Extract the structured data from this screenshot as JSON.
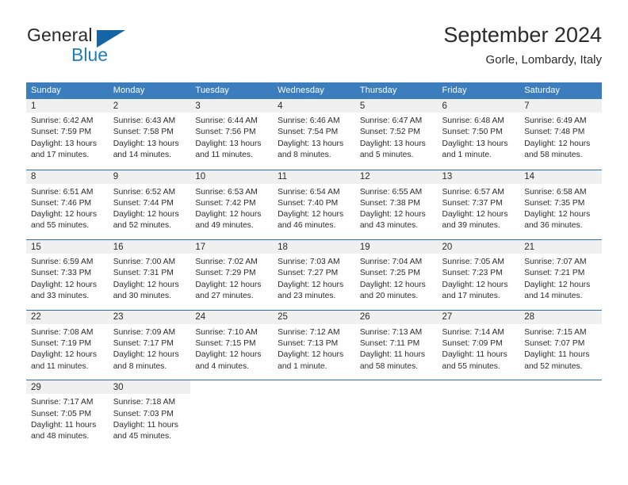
{
  "brand": {
    "name_part1": "General",
    "name_part2": "Blue",
    "triangle_color": "#1565a6",
    "blue_color": "#1f7ec4"
  },
  "header": {
    "title": "September 2024",
    "subtitle": "Gorle, Lombardy, Italy"
  },
  "theme": {
    "header_row_bg": "#3c7ebd",
    "week_divider": "#2f6fae",
    "day_band_bg": "#f0f0f0",
    "text": "#2b2b2b"
  },
  "weekday_headers": [
    "Sunday",
    "Monday",
    "Tuesday",
    "Wednesday",
    "Thursday",
    "Friday",
    "Saturday"
  ],
  "weeks": [
    [
      {
        "day": "1",
        "sunrise": "Sunrise: 6:42 AM",
        "sunset": "Sunset: 7:59 PM",
        "daylight_line1": "Daylight: 13 hours",
        "daylight_line2": "and 17 minutes."
      },
      {
        "day": "2",
        "sunrise": "Sunrise: 6:43 AM",
        "sunset": "Sunset: 7:58 PM",
        "daylight_line1": "Daylight: 13 hours",
        "daylight_line2": "and 14 minutes."
      },
      {
        "day": "3",
        "sunrise": "Sunrise: 6:44 AM",
        "sunset": "Sunset: 7:56 PM",
        "daylight_line1": "Daylight: 13 hours",
        "daylight_line2": "and 11 minutes."
      },
      {
        "day": "4",
        "sunrise": "Sunrise: 6:46 AM",
        "sunset": "Sunset: 7:54 PM",
        "daylight_line1": "Daylight: 13 hours",
        "daylight_line2": "and 8 minutes."
      },
      {
        "day": "5",
        "sunrise": "Sunrise: 6:47 AM",
        "sunset": "Sunset: 7:52 PM",
        "daylight_line1": "Daylight: 13 hours",
        "daylight_line2": "and 5 minutes."
      },
      {
        "day": "6",
        "sunrise": "Sunrise: 6:48 AM",
        "sunset": "Sunset: 7:50 PM",
        "daylight_line1": "Daylight: 13 hours",
        "daylight_line2": "and 1 minute."
      },
      {
        "day": "7",
        "sunrise": "Sunrise: 6:49 AM",
        "sunset": "Sunset: 7:48 PM",
        "daylight_line1": "Daylight: 12 hours",
        "daylight_line2": "and 58 minutes."
      }
    ],
    [
      {
        "day": "8",
        "sunrise": "Sunrise: 6:51 AM",
        "sunset": "Sunset: 7:46 PM",
        "daylight_line1": "Daylight: 12 hours",
        "daylight_line2": "and 55 minutes."
      },
      {
        "day": "9",
        "sunrise": "Sunrise: 6:52 AM",
        "sunset": "Sunset: 7:44 PM",
        "daylight_line1": "Daylight: 12 hours",
        "daylight_line2": "and 52 minutes."
      },
      {
        "day": "10",
        "sunrise": "Sunrise: 6:53 AM",
        "sunset": "Sunset: 7:42 PM",
        "daylight_line1": "Daylight: 12 hours",
        "daylight_line2": "and 49 minutes."
      },
      {
        "day": "11",
        "sunrise": "Sunrise: 6:54 AM",
        "sunset": "Sunset: 7:40 PM",
        "daylight_line1": "Daylight: 12 hours",
        "daylight_line2": "and 46 minutes."
      },
      {
        "day": "12",
        "sunrise": "Sunrise: 6:55 AM",
        "sunset": "Sunset: 7:38 PM",
        "daylight_line1": "Daylight: 12 hours",
        "daylight_line2": "and 43 minutes."
      },
      {
        "day": "13",
        "sunrise": "Sunrise: 6:57 AM",
        "sunset": "Sunset: 7:37 PM",
        "daylight_line1": "Daylight: 12 hours",
        "daylight_line2": "and 39 minutes."
      },
      {
        "day": "14",
        "sunrise": "Sunrise: 6:58 AM",
        "sunset": "Sunset: 7:35 PM",
        "daylight_line1": "Daylight: 12 hours",
        "daylight_line2": "and 36 minutes."
      }
    ],
    [
      {
        "day": "15",
        "sunrise": "Sunrise: 6:59 AM",
        "sunset": "Sunset: 7:33 PM",
        "daylight_line1": "Daylight: 12 hours",
        "daylight_line2": "and 33 minutes."
      },
      {
        "day": "16",
        "sunrise": "Sunrise: 7:00 AM",
        "sunset": "Sunset: 7:31 PM",
        "daylight_line1": "Daylight: 12 hours",
        "daylight_line2": "and 30 minutes."
      },
      {
        "day": "17",
        "sunrise": "Sunrise: 7:02 AM",
        "sunset": "Sunset: 7:29 PM",
        "daylight_line1": "Daylight: 12 hours",
        "daylight_line2": "and 27 minutes."
      },
      {
        "day": "18",
        "sunrise": "Sunrise: 7:03 AM",
        "sunset": "Sunset: 7:27 PM",
        "daylight_line1": "Daylight: 12 hours",
        "daylight_line2": "and 23 minutes."
      },
      {
        "day": "19",
        "sunrise": "Sunrise: 7:04 AM",
        "sunset": "Sunset: 7:25 PM",
        "daylight_line1": "Daylight: 12 hours",
        "daylight_line2": "and 20 minutes."
      },
      {
        "day": "20",
        "sunrise": "Sunrise: 7:05 AM",
        "sunset": "Sunset: 7:23 PM",
        "daylight_line1": "Daylight: 12 hours",
        "daylight_line2": "and 17 minutes."
      },
      {
        "day": "21",
        "sunrise": "Sunrise: 7:07 AM",
        "sunset": "Sunset: 7:21 PM",
        "daylight_line1": "Daylight: 12 hours",
        "daylight_line2": "and 14 minutes."
      }
    ],
    [
      {
        "day": "22",
        "sunrise": "Sunrise: 7:08 AM",
        "sunset": "Sunset: 7:19 PM",
        "daylight_line1": "Daylight: 12 hours",
        "daylight_line2": "and 11 minutes."
      },
      {
        "day": "23",
        "sunrise": "Sunrise: 7:09 AM",
        "sunset": "Sunset: 7:17 PM",
        "daylight_line1": "Daylight: 12 hours",
        "daylight_line2": "and 8 minutes."
      },
      {
        "day": "24",
        "sunrise": "Sunrise: 7:10 AM",
        "sunset": "Sunset: 7:15 PM",
        "daylight_line1": "Daylight: 12 hours",
        "daylight_line2": "and 4 minutes."
      },
      {
        "day": "25",
        "sunrise": "Sunrise: 7:12 AM",
        "sunset": "Sunset: 7:13 PM",
        "daylight_line1": "Daylight: 12 hours",
        "daylight_line2": "and 1 minute."
      },
      {
        "day": "26",
        "sunrise": "Sunrise: 7:13 AM",
        "sunset": "Sunset: 7:11 PM",
        "daylight_line1": "Daylight: 11 hours",
        "daylight_line2": "and 58 minutes."
      },
      {
        "day": "27",
        "sunrise": "Sunrise: 7:14 AM",
        "sunset": "Sunset: 7:09 PM",
        "daylight_line1": "Daylight: 11 hours",
        "daylight_line2": "and 55 minutes."
      },
      {
        "day": "28",
        "sunrise": "Sunrise: 7:15 AM",
        "sunset": "Sunset: 7:07 PM",
        "daylight_line1": "Daylight: 11 hours",
        "daylight_line2": "and 52 minutes."
      }
    ],
    [
      {
        "day": "29",
        "sunrise": "Sunrise: 7:17 AM",
        "sunset": "Sunset: 7:05 PM",
        "daylight_line1": "Daylight: 11 hours",
        "daylight_line2": "and 48 minutes."
      },
      {
        "day": "30",
        "sunrise": "Sunrise: 7:18 AM",
        "sunset": "Sunset: 7:03 PM",
        "daylight_line1": "Daylight: 11 hours",
        "daylight_line2": "and 45 minutes."
      },
      {
        "day": "",
        "sunrise": "",
        "sunset": "",
        "daylight_line1": "",
        "daylight_line2": ""
      },
      {
        "day": "",
        "sunrise": "",
        "sunset": "",
        "daylight_line1": "",
        "daylight_line2": ""
      },
      {
        "day": "",
        "sunrise": "",
        "sunset": "",
        "daylight_line1": "",
        "daylight_line2": ""
      },
      {
        "day": "",
        "sunrise": "",
        "sunset": "",
        "daylight_line1": "",
        "daylight_line2": ""
      },
      {
        "day": "",
        "sunrise": "",
        "sunset": "",
        "daylight_line1": "",
        "daylight_line2": ""
      }
    ]
  ]
}
